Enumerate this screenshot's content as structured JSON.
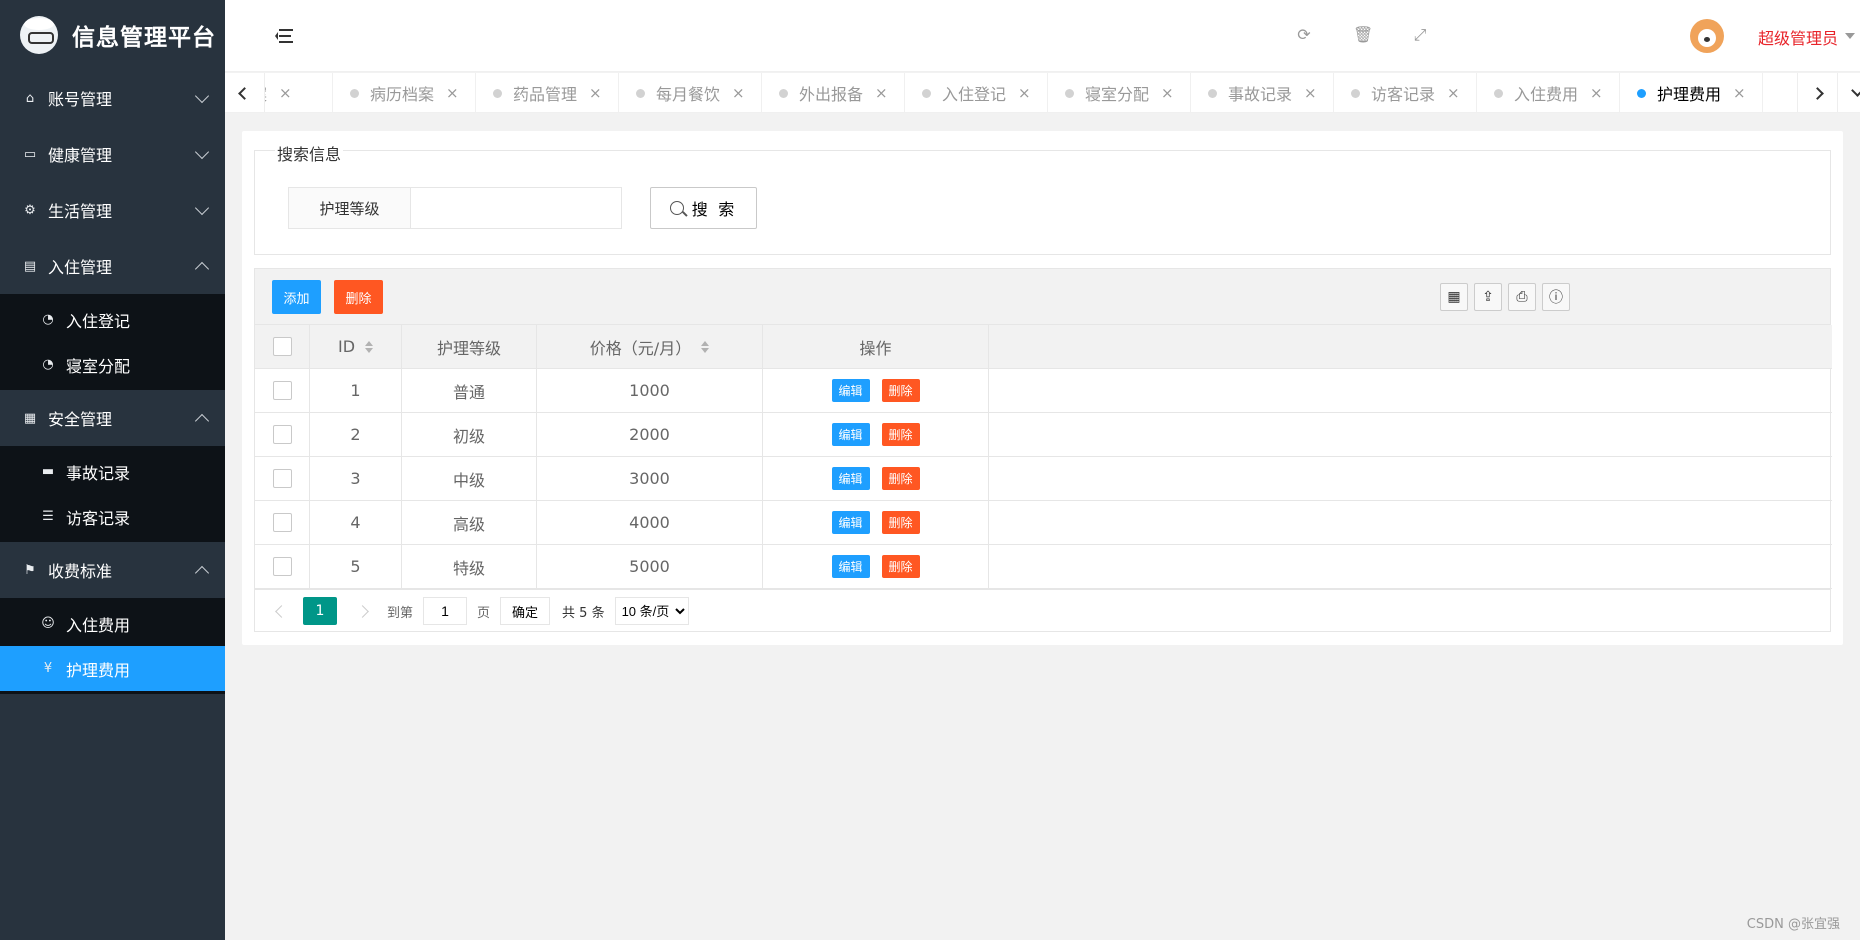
{
  "app": {
    "title": "信息管理平台"
  },
  "sidebar": {
    "groups": [
      {
        "label": "账号管理",
        "icon": "home-icon",
        "expanded": false,
        "items": []
      },
      {
        "label": "健康管理",
        "icon": "window-icon",
        "expanded": false,
        "items": []
      },
      {
        "label": "生活管理",
        "icon": "gears-icon",
        "expanded": false,
        "items": []
      },
      {
        "label": "入住管理",
        "icon": "file-icon",
        "expanded": true,
        "items": [
          {
            "label": "入住登记",
            "icon": "dashboard-icon"
          },
          {
            "label": "寝室分配",
            "icon": "dashboard-icon"
          }
        ]
      },
      {
        "label": "安全管理",
        "icon": "calendar-icon",
        "expanded": true,
        "items": [
          {
            "label": "事故记录",
            "icon": "card-icon"
          },
          {
            "label": "访客记录",
            "icon": "list-icon"
          }
        ]
      },
      {
        "label": "收费标准",
        "icon": "flag-icon",
        "expanded": true,
        "items": [
          {
            "label": "入住费用",
            "icon": "smile-icon"
          },
          {
            "label": "护理费用",
            "icon": "yen-icon",
            "active": true
          }
        ]
      }
    ]
  },
  "header": {
    "username": "超级管理员",
    "icons": [
      "refresh-icon",
      "trash-icon",
      "fullscreen-icon"
    ]
  },
  "tabs": [
    {
      "label": "档案",
      "active": false
    },
    {
      "label": "病历档案",
      "active": false
    },
    {
      "label": "药品管理",
      "active": false
    },
    {
      "label": "每月餐饮",
      "active": false
    },
    {
      "label": "外出报备",
      "active": false
    },
    {
      "label": "入住登记",
      "active": false
    },
    {
      "label": "寝室分配",
      "active": false
    },
    {
      "label": "事故记录",
      "active": false
    },
    {
      "label": "访客记录",
      "active": false
    },
    {
      "label": "入住费用",
      "active": false
    },
    {
      "label": "护理费用",
      "active": true
    }
  ],
  "search": {
    "legend": "搜索信息",
    "label": "护理等级",
    "value": "",
    "placeholder": "",
    "button_label": "搜 索"
  },
  "toolbar": {
    "add_label": "添加",
    "delete_label": "删除",
    "tools": [
      "columns-icon",
      "export-icon",
      "print-icon",
      "info-icon"
    ]
  },
  "table": {
    "headers": {
      "id": "ID",
      "level": "护理等级",
      "price": "价格（元/月）",
      "op": "操作"
    },
    "rows": [
      {
        "id": "1",
        "level": "普通",
        "price": "1000"
      },
      {
        "id": "2",
        "level": "初级",
        "price": "2000"
      },
      {
        "id": "3",
        "level": "中级",
        "price": "3000"
      },
      {
        "id": "4",
        "level": "高级",
        "price": "4000"
      },
      {
        "id": "5",
        "level": "特级",
        "price": "5000"
      }
    ],
    "edit_label": "编辑",
    "delete_label": "删除"
  },
  "pager": {
    "current": "1",
    "goto_label": "到第",
    "goto_value": "1",
    "page_label": "页",
    "ok_label": "确定",
    "total_label": "共 5 条",
    "page_size": "10 条/页"
  },
  "watermark": "CSDN @张宜强"
}
